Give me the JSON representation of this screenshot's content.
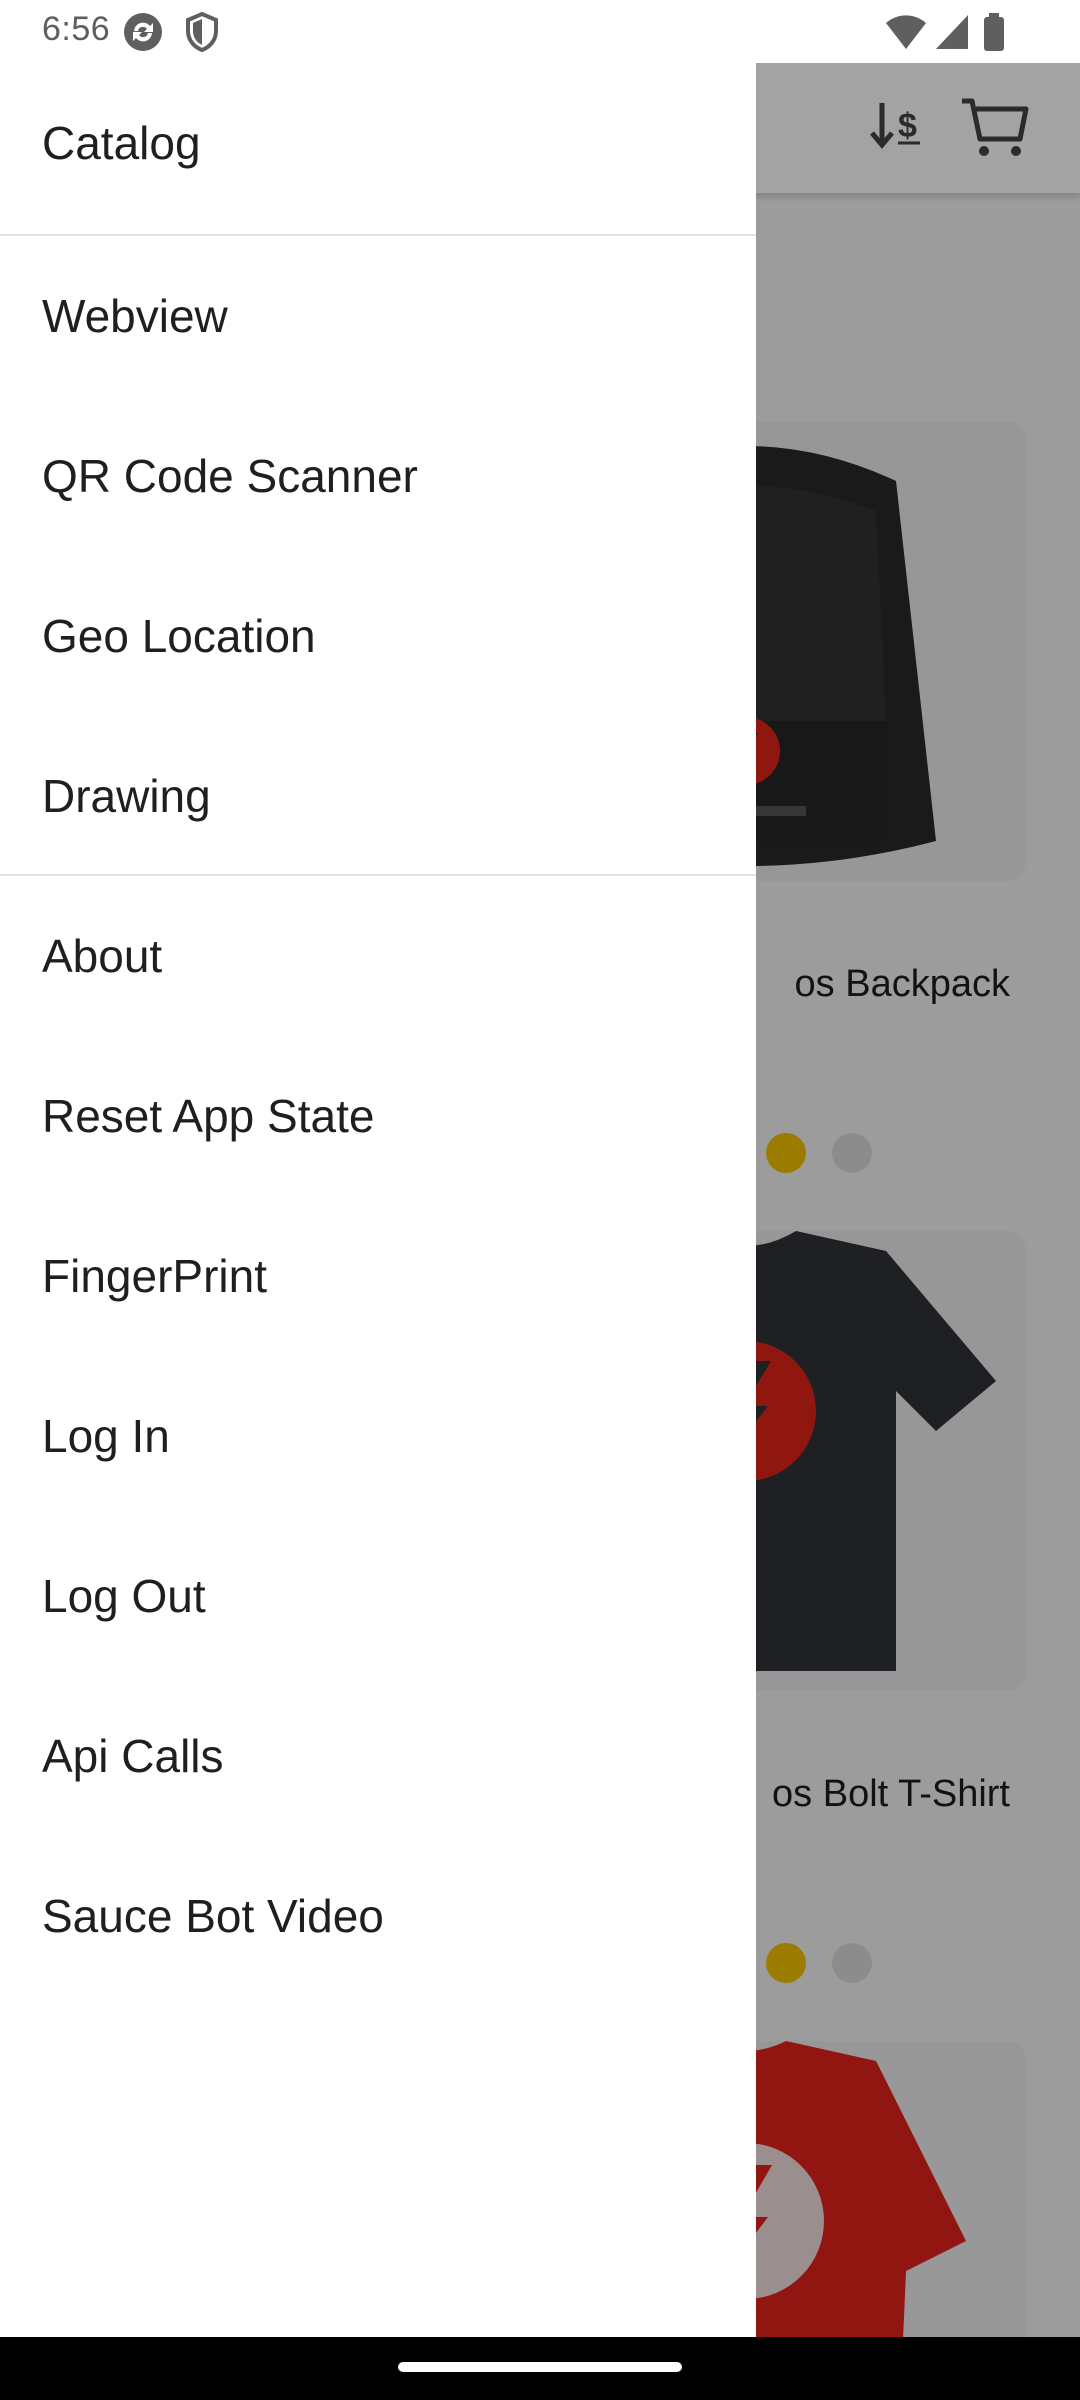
{
  "status_bar": {
    "time": "6:56",
    "left_icons": [
      "sync-icon",
      "shield-icon"
    ],
    "right_icons": [
      "wifi-icon",
      "signal-icon",
      "battery-icon"
    ]
  },
  "header": {
    "icons": [
      "sort-price-icon",
      "cart-icon"
    ]
  },
  "products": [
    {
      "name_visible": "os Backpack",
      "rating_icons": [
        "star-filled-icon",
        "star-empty-icon"
      ]
    },
    {
      "name_visible": "os Bolt T-Shirt",
      "rating_icons": [
        "star-filled-icon",
        "star-empty-icon"
      ]
    },
    {
      "name_visible": ""
    }
  ],
  "drawer": {
    "items": [
      {
        "label": "Catalog"
      },
      {
        "label": "Webview"
      },
      {
        "label": "QR Code Scanner"
      },
      {
        "label": "Geo Location"
      },
      {
        "label": "Drawing"
      },
      {
        "label": "About"
      },
      {
        "label": "Reset App State"
      },
      {
        "label": "FingerPrint"
      },
      {
        "label": "Log In"
      },
      {
        "label": "Log Out"
      },
      {
        "label": "Api Calls"
      },
      {
        "label": "Sauce Bot Video"
      }
    ]
  },
  "colors": {
    "star_filled": "#f2c200",
    "brand_red": "#e2231a",
    "scrim": "#000000"
  }
}
